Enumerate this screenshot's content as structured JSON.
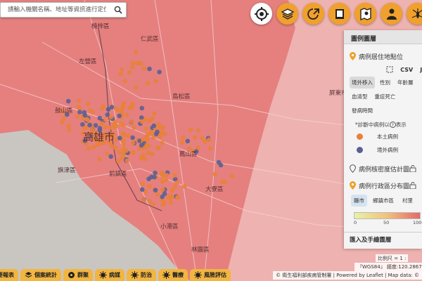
{
  "search": {
    "placeholder": "請輸入機關名稱、地址等資訊進行定位"
  },
  "map": {
    "place_labels": [
      {
        "id": "kaohsiung",
        "text": "高雄市"
      },
      {
        "id": "renwu",
        "text": "仁武區"
      },
      {
        "id": "niaosong",
        "text": "鳥松區"
      },
      {
        "id": "fengshan",
        "text": "鳳山區"
      },
      {
        "id": "daliao",
        "text": "大寮區"
      },
      {
        "id": "pingtung",
        "text": "屏東市"
      },
      {
        "id": "qianzhen",
        "text": "前鎮區"
      },
      {
        "id": "xiaogang",
        "text": "小港區"
      },
      {
        "id": "gushan",
        "text": "鼓山區"
      },
      {
        "id": "zuoying",
        "text": "左營區"
      },
      {
        "id": "linyuan",
        "text": "林園區"
      },
      {
        "id": "qijin",
        "text": "旗津區"
      },
      {
        "id": "nanzi",
        "text": "楠梓區"
      }
    ],
    "colors": {
      "local_case": "#e8813b",
      "imported_case": "#5b5f95",
      "region_fill": "#e46a6a"
    }
  },
  "toolbar": {
    "buttons": [
      {
        "id": "locate",
        "icon": "locate-icon",
        "active": false
      },
      {
        "id": "layers",
        "icon": "layers-icon",
        "active": true
      },
      {
        "id": "export",
        "icon": "export-icon",
        "active": false
      },
      {
        "id": "book",
        "icon": "book-icon",
        "active": false
      },
      {
        "id": "map",
        "icon": "map-icon",
        "active": false
      },
      {
        "id": "person",
        "icon": "person-icon",
        "active": false
      },
      {
        "id": "mosquito",
        "icon": "mosquito-icon",
        "active": false
      }
    ]
  },
  "panel": {
    "title": "圖例圖層",
    "sections": {
      "residence": "病例居住地點位",
      "density": "病例核密度估計圖",
      "district": "病例行政區分布圖"
    },
    "downloads": {
      "csv": "CSV",
      "json": "JS"
    },
    "tabs": [
      "境外移入",
      "性別",
      "年齡層",
      "血清型",
      "重症死亡",
      "發病時間"
    ],
    "note_prefix": "*診斷中病例以",
    "note_suffix": "表示",
    "legend": [
      {
        "label": "本土病例",
        "color": "#e8813b"
      },
      {
        "label": "境外病例",
        "color": "#5b5f95"
      }
    ],
    "sub_tabs": [
      "縣市",
      "鄉鎮市區",
      "村里"
    ],
    "gradient_ticks": [
      "0",
      "50",
      "100"
    ],
    "footer": "匯入及手繪圖層"
  },
  "scale": {
    "label": "比例尺 = 1 :"
  },
  "coords": {
    "text": "『WGS84』 經度:120.2867, 緯度:"
  },
  "attribution": {
    "text": "© 衛生福利部疾病管制署 | Powered by Leaflet | Map data: ©"
  },
  "bottom_tabs": [
    {
      "label": "要報表",
      "icon": "report-icon"
    },
    {
      "label": "個案統計",
      "icon": "stack-icon"
    },
    {
      "label": "群聚",
      "icon": "cluster-icon"
    },
    {
      "label": "病媒",
      "icon": "virus-icon"
    },
    {
      "label": "防治",
      "icon": "virus-icon"
    },
    {
      "label": "醫療",
      "icon": "virus-icon"
    },
    {
      "label": "風險評估",
      "icon": "virus-icon"
    }
  ]
}
